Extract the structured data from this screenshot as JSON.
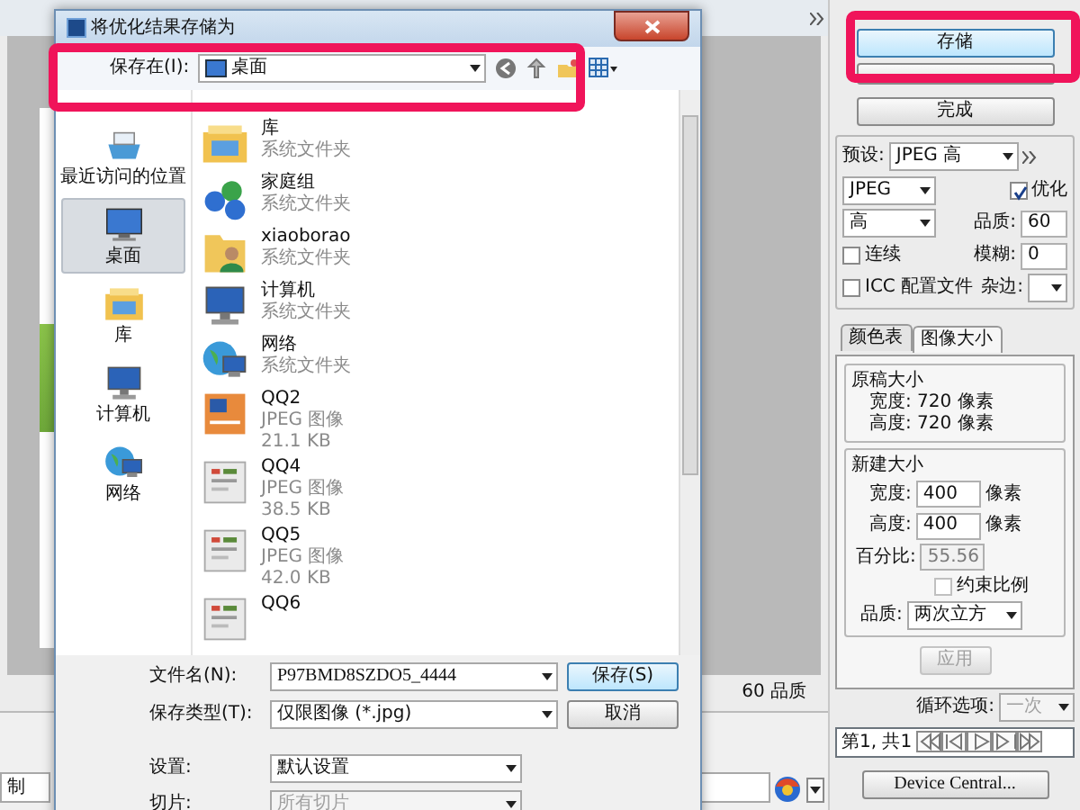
{
  "app": {
    "left_field": "制",
    "preview_status": "60 品质",
    "panel": {
      "save_button": "存储",
      "done_button": "完成",
      "preset": {
        "label": "预设:",
        "value": "JPEG 高"
      },
      "format": "JPEG",
      "optimized": {
        "label": "优化",
        "checked": true
      },
      "quality_preset": "高",
      "quality": {
        "label": "品质:",
        "value": "60"
      },
      "progressive": {
        "label": "连续",
        "checked": false
      },
      "blur": {
        "label": "模糊:",
        "value": "0"
      },
      "icc": {
        "label": "ICC 配置文件",
        "checked": false
      },
      "matte": {
        "label": "杂边:"
      },
      "tabs": [
        {
          "label": "颜色表",
          "selected": false
        },
        {
          "label": "图像大小",
          "selected": true
        }
      ],
      "original_size": {
        "title": "原稿大小",
        "lines": [
          "宽度: 720 像素",
          "高度: 720 像素"
        ]
      },
      "new_size": {
        "title": "新建大小",
        "rows": [
          {
            "label": "宽度:",
            "value": "400",
            "unit": "像素"
          },
          {
            "label": "高度:",
            "value": "400",
            "unit": "像素"
          }
        ],
        "percent": {
          "label": "百分比:",
          "value": "55.56",
          "disabled": true
        },
        "constrain": {
          "label": "约束比例",
          "checked": false
        },
        "quality": {
          "label": "品质:",
          "value": "两次立方"
        }
      },
      "apply": {
        "label": "应用",
        "disabled": true
      },
      "loop": {
        "label": "循环选项:",
        "value": "一次",
        "disabled": true
      },
      "frame": "第1, 共1",
      "device_central": "Device Central..."
    }
  },
  "dialog": {
    "title": "将优化结果存储为",
    "save_in": {
      "label": "保存在(I):",
      "value": "桌面"
    },
    "places": [
      {
        "label": "最近访问的位置",
        "kind": "recent",
        "selected": false
      },
      {
        "label": "桌面",
        "kind": "desktop",
        "selected": true
      },
      {
        "label": "库",
        "kind": "library",
        "selected": false
      },
      {
        "label": "计算机",
        "kind": "computer",
        "selected": false
      },
      {
        "label": "网络",
        "kind": "network",
        "selected": false
      }
    ],
    "files": [
      {
        "name": "库",
        "type": "系统文件夹",
        "kind": "library"
      },
      {
        "name": "家庭组",
        "type": "系统文件夹",
        "kind": "homegroup"
      },
      {
        "name": "xiaoborao",
        "type": "系统文件夹",
        "kind": "user"
      },
      {
        "name": "计算机",
        "type": "系统文件夹",
        "kind": "computer"
      },
      {
        "name": "网络",
        "type": "系统文件夹",
        "kind": "network"
      },
      {
        "name": "QQ2",
        "type": "JPEG 图像",
        "size": "21.1 KB",
        "kind": "psdoc"
      },
      {
        "name": "QQ4",
        "type": "JPEG 图像",
        "size": "38.5 KB",
        "kind": "shot"
      },
      {
        "name": "QQ5",
        "type": "JPEG 图像",
        "size": "42.0 KB",
        "kind": "shot"
      },
      {
        "name": "QQ6",
        "kind": "shot"
      }
    ],
    "filename": {
      "label": "文件名(N):",
      "value": "P97BMD8SZDO5_4444"
    },
    "filetype": {
      "label": "保存类型(T):",
      "value": "仅限图像 (*.jpg)"
    },
    "save": "保存(S)",
    "cancel": "取消",
    "settings": {
      "label": "设置:",
      "value": "默认设置"
    },
    "slices": {
      "label": "切片:",
      "value": "所有切片",
      "disabled": true
    }
  }
}
